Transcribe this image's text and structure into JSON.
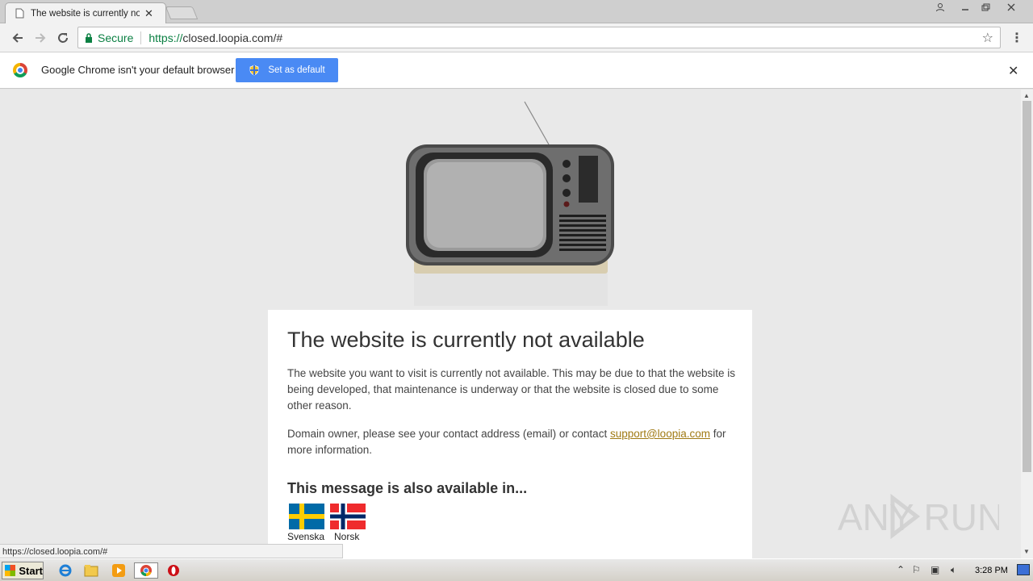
{
  "browser": {
    "tab_title": "The website is currently not available",
    "tab_close": "✕",
    "secure_label": "Secure",
    "url_scheme": "https://",
    "url_rest": "closed.loopia.com/#",
    "status_url": "https://closed.loopia.com/#"
  },
  "infobar": {
    "message": "Google Chrome isn't your default browser",
    "button_label": "Set as default",
    "close": "✕"
  },
  "content": {
    "heading": "The website is currently not available",
    "paragraph1": "The website you want to visit is currently not available. This may be due to that the website is being developed, that maintenance is underway or that the website is closed due to some other reason.",
    "paragraph2_prefix": "Domain owner, please see your contact address (email) or contact ",
    "support_email": "support@loopia.com",
    "paragraph2_suffix": " for more information.",
    "languages_heading": "This message is also available in...",
    "languages": [
      {
        "label": "Svenska"
      },
      {
        "label": "Norsk"
      }
    ]
  },
  "watermark": {
    "text": "ANY RUN"
  },
  "taskbar": {
    "start_label": "Start",
    "clock": "3:28 PM"
  },
  "colors": {
    "accent": "#4a8af4",
    "secure_green": "#0b8043",
    "link": "#a07a14"
  }
}
